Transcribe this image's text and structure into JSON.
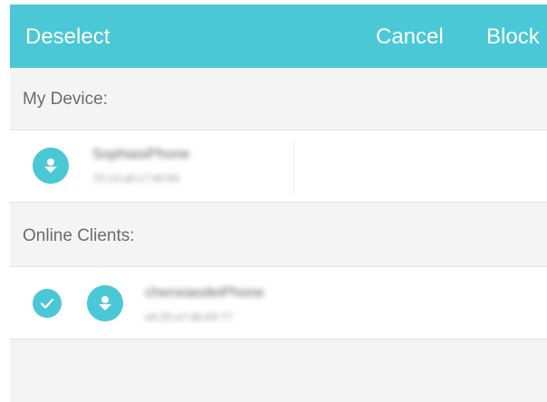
{
  "toolbar": {
    "deselect_label": "Deselect",
    "cancel_label": "Cancel",
    "block_label": "Block"
  },
  "sections": {
    "my_device_title": "My Device:",
    "online_clients_title": "Online Clients:"
  },
  "my_device": {
    "name": "SophiasiPhone",
    "mac": "70:14:a6:c7:40:84",
    "icon": "download-user-icon"
  },
  "online_clients": [
    {
      "name": "chenxiaodeiPhone",
      "mac": "a4:20:a7:db:84:77",
      "icon": "download-user-icon",
      "selected": true
    }
  ],
  "colors": {
    "accent": "#4ac8d6",
    "background": "#f4f4f4",
    "row_background": "#ffffff",
    "header_text": "#6b6b6b"
  }
}
